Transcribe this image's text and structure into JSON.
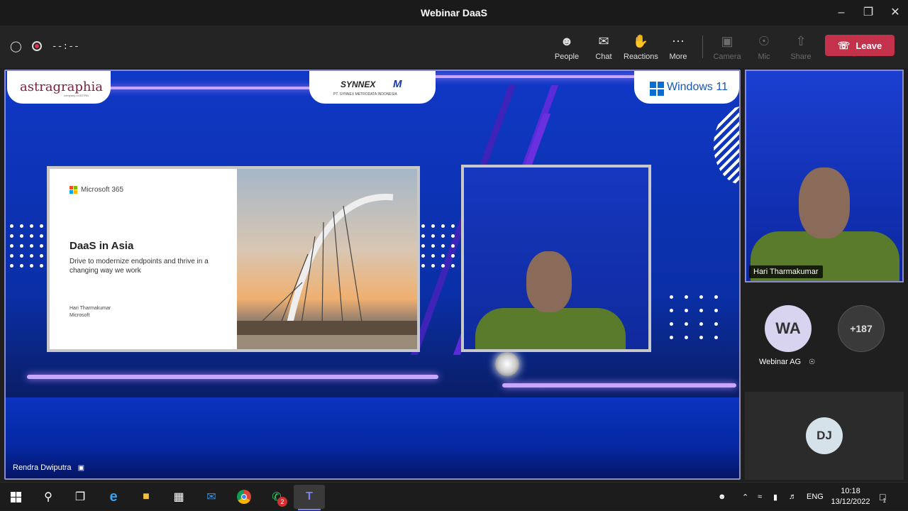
{
  "window": {
    "title": "Webinar DaaS"
  },
  "toolbar": {
    "timer": "--:--",
    "people": "People",
    "chat": "Chat",
    "reactions": "Reactions",
    "more": "More",
    "camera": "Camera",
    "mic": "Mic",
    "share": "Share",
    "leave": "Leave"
  },
  "stage": {
    "brand_left": "astragraphia",
    "brand_left_sub": "company of ASTRA",
    "brand_center": "SYNNEX",
    "brand_center_sub": "PT. SYNNEX METRODATA INDONESIA",
    "brand_right": "Windows 11",
    "presenter_name": "Rendra Dwiputra"
  },
  "slide": {
    "product": "Microsoft 365",
    "title": "DaaS in Asia",
    "subtitle": "Drive to modernize endpoints and thrive in a changing way we work",
    "speaker": "Hari Tharmakumar",
    "company": "Microsoft"
  },
  "participants": {
    "speaker_tile_name": "Hari Tharmakumar",
    "wa_initials": "WA",
    "wa_name": "Webinar AG",
    "overflow": "+187",
    "dj_initials": "DJ"
  },
  "taskbar": {
    "whatsapp_badge": "2",
    "lang": "ENG",
    "time": "10:18",
    "date": "13/12/2022",
    "notifications": "1"
  },
  "colors": {
    "leave": "#c4314b",
    "accent": "#8b8cc7",
    "stage_blue": "#0b2fa8"
  }
}
